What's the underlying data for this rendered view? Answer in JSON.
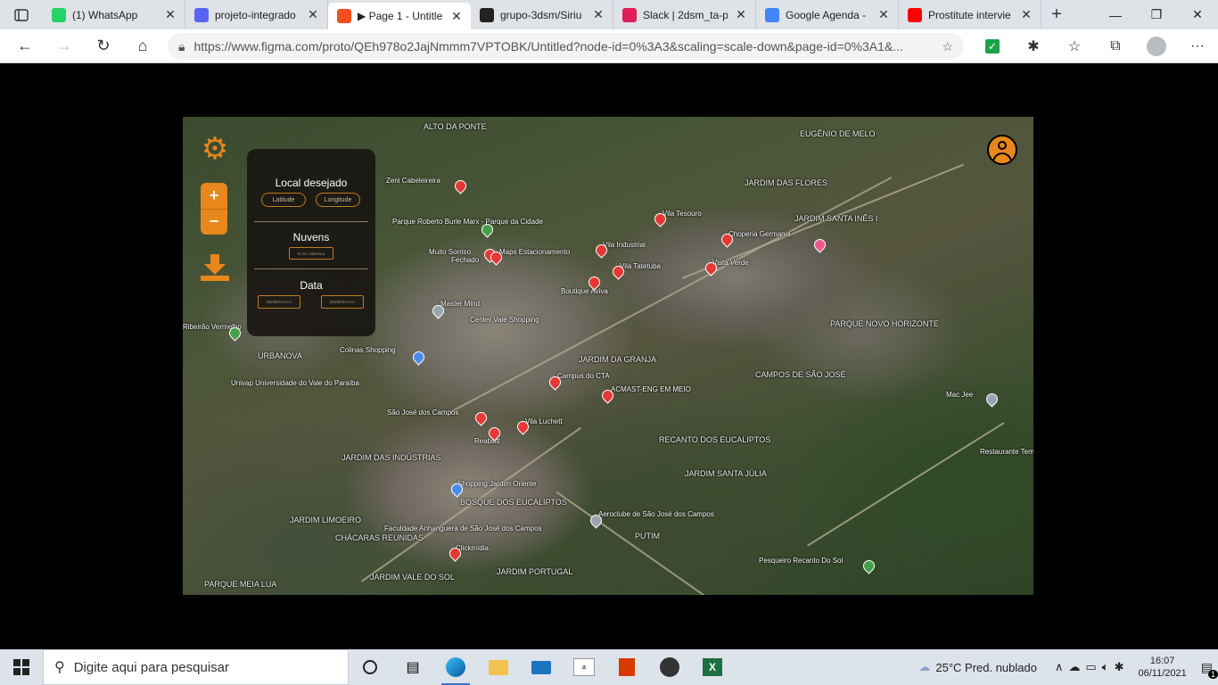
{
  "browser": {
    "tabs": [
      {
        "title": "(1) WhatsApp",
        "icon": "whatsapp-icon",
        "color": "#25d366"
      },
      {
        "title": "projeto-integrado",
        "icon": "discord-icon",
        "color": "#5865f2"
      },
      {
        "title": "▶ Page 1 - Untitle",
        "icon": "figma-icon",
        "color": "#f24e1e",
        "active": true
      },
      {
        "title": "grupo-3dsm/Siriu",
        "icon": "github-icon",
        "color": "#222222"
      },
      {
        "title": "Slack | 2dsm_ta-p",
        "icon": "slack-icon",
        "color": "#e01e5a"
      },
      {
        "title": "Google Agenda -",
        "icon": "google-calendar-icon",
        "color": "#4285f4"
      },
      {
        "title": "Prostitute intervie",
        "icon": "youtube-icon",
        "color": "#ff0000"
      }
    ],
    "url": "https://www.figma.com/proto/QEh978o2JajNmmm7VPTOBK/Untitled?node-id=0%3A3&scaling=scale-down&page-id=0%3A1&..."
  },
  "panel": {
    "local_title": "Local desejado",
    "latitude": "Latitude",
    "longitude": "Longitude",
    "clouds_title": "Nuvens",
    "clouds_value": "% de cobertura",
    "date_title": "Data",
    "date_from": "DD/MM/AAAA",
    "date_to": "DD/MM/AAAA"
  },
  "zoom": {
    "plus": "+",
    "minus": "−"
  },
  "map_labels": [
    {
      "text": "ALTO DA PONTE"
    },
    {
      "text": "Zeni Cabeleireira"
    },
    {
      "text": "Parque Roberto Burle Marx - Parque da Cidade"
    },
    {
      "text": "Muito Sorriso"
    },
    {
      "text": "Fechado"
    },
    {
      "text": "Maps Estacionamento"
    },
    {
      "text": "Master Mind"
    },
    {
      "text": "Center Vale Shopping"
    },
    {
      "text": "Colinas Shopping"
    },
    {
      "text": "URBANOVA"
    },
    {
      "text": "Univap Universidade do Vale do Paraíba"
    },
    {
      "text": "São José dos Campos"
    },
    {
      "text": "Reabilitt"
    },
    {
      "text": "Vila Luchett"
    },
    {
      "text": "JARDIM DAS INDÚSTRIAS"
    },
    {
      "text": "Shopping Jardim Oriente"
    },
    {
      "text": "BOSQUE DOS EUCALIPTOS"
    },
    {
      "text": "JARDIM LIMOEIRO"
    },
    {
      "text": "CHÁCARAS REUNIDAS"
    },
    {
      "text": "Faculdade Anhanguera de São José dos Campos"
    },
    {
      "text": "Clickmídia"
    },
    {
      "text": "JARDIM PORTUGAL"
    },
    {
      "text": "JARDIM VALE DO SOL"
    },
    {
      "text": "PARQUE MEIA LUA"
    },
    {
      "text": "Aeroclube de São José dos Campos"
    },
    {
      "text": "PUTIM"
    },
    {
      "text": "Campus do CTA"
    },
    {
      "text": "JARDIM DA GRANJA"
    },
    {
      "text": "ACMAST-ENG EM MEIO"
    },
    {
      "text": "RECANTO DOS EUCALIPTOS"
    },
    {
      "text": "JARDIM SANTA JÚLIA"
    },
    {
      "text": "Vila Tesouro"
    },
    {
      "text": "Vila Industrial"
    },
    {
      "text": "Vila Tatetuba"
    },
    {
      "text": "Boutique Aviva"
    },
    {
      "text": "Choperia Germania"
    },
    {
      "text": "Vista Verde"
    },
    {
      "text": "JARDIM DAS FLORES"
    },
    {
      "text": "EUGÊNIO DE MELO"
    },
    {
      "text": "JARDIM SANTA INÊS I"
    },
    {
      "text": "PARQUE NOVO HORIZONTE"
    },
    {
      "text": "CAMPOS DE SÃO JOSÉ"
    },
    {
      "text": "Mac Jee"
    },
    {
      "text": "Restaurante Tempero Caip"
    },
    {
      "text": "Pesqueiro Recanto Do Sol"
    },
    {
      "text": "Ribeirão Vermelho"
    }
  ],
  "taskbar": {
    "search_placeholder": "Digite aqui para pesquisar",
    "weather": "25°C  Pred. nublado",
    "time": "16:07",
    "date": "06/11/2021",
    "notification_count": "1"
  }
}
